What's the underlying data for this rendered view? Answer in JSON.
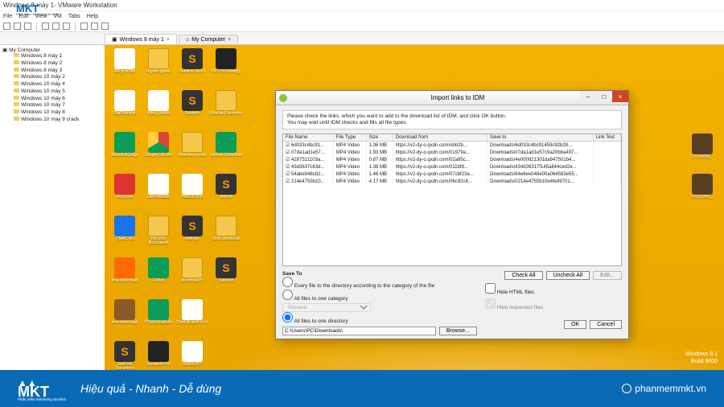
{
  "app": {
    "title_suffix": " - VMware Workstation"
  },
  "menu": [
    "File",
    "Edit",
    "View",
    "VM",
    "Tabs",
    "Help"
  ],
  "tabs": [
    {
      "label": "Windows 8 máy 1",
      "active": true
    },
    {
      "label": "My Computer",
      "active": false
    }
  ],
  "tree": {
    "root": "My Computer",
    "items": [
      "Windows 8 máy 1",
      "Windows 8 máy 2",
      "Windows 8 máy 3",
      "Windows 10 máy 2",
      "Windows 10 máy 4",
      "Windows 10 máy 5",
      "Windows 10 máy 6",
      "Windows 10 máy 7",
      "Windows 10 máy 8",
      "Windows 10 may 9 crack"
    ]
  },
  "desktop_icons": [
    {
      "label": "Recycle Bin",
      "cls": "col-white"
    },
    {
      "label": "regioncyjetim",
      "cls": "col-folder"
    },
    {
      "label": "Sublime Text 3",
      "cls": "col-subl"
    },
    {
      "label": "HTTPS Debuggr",
      "cls": "col-dark"
    },
    {
      "label": "CaalShavesc",
      "cls": "col-white"
    },
    {
      "label": "chen_Lun.txt",
      "cls": "col-white"
    },
    {
      "label": "Sublextr",
      "cls": "col-subl"
    },
    {
      "label": "Khardat Document",
      "cls": "col-folder"
    },
    {
      "label": "Microsoft Edge",
      "cls": "col-green"
    },
    {
      "label": "Google Chrome",
      "cls": "col-chrome"
    },
    {
      "label": "Kharekeyr code",
      "cls": "col-folder"
    },
    {
      "label": "Internet Download",
      "cls": "col-green"
    },
    {
      "label": "AnyDesk",
      "cls": "col-red"
    },
    {
      "label": "Làm website",
      "cls": "col-white"
    },
    {
      "label": "5442067095",
      "cls": "col-white"
    },
    {
      "label": "video8",
      "cls": "col-subl"
    },
    {
      "label": "TMAC v6",
      "cls": "col-blue"
    },
    {
      "label": "mycycle filcctioalset",
      "cls": "col-folder"
    },
    {
      "label": "videopy",
      "cls": "col-subl"
    },
    {
      "label": "code download",
      "cls": "col-folder"
    },
    {
      "label": "time-download",
      "cls": "col-orange"
    },
    {
      "label": "FPlus",
      "cls": "col-green"
    },
    {
      "label": "dienthoaiPP",
      "cls": "col-folder"
    },
    {
      "label": "Sublslot",
      "cls": "col-subl"
    },
    {
      "label": "time-download",
      "cls": "col-brown"
    },
    {
      "label": "FPlusScheduler",
      "cls": "col-green"
    },
    {
      "label": "Thiết kế web cơ b",
      "cls": "col-white"
    },
    {
      "label": "",
      "cls": ""
    },
    {
      "label": "SublText Document",
      "cls": "col-subl"
    },
    {
      "label": "UpdateAPKs",
      "cls": "col-dark"
    },
    {
      "label": "UniKeyNT",
      "cls": "col-white"
    }
  ],
  "right_icons": [
    {
      "label": "DT29998_"
    },
    {
      "label": "DT191841_"
    }
  ],
  "dialog": {
    "title": "Import links to IDM",
    "message_l1": "Please check the links, which you want to add to the download list of IDM, and click OK button.",
    "message_l2": "You may wait until IDM checks and fills all file types.",
    "columns": [
      "File Name",
      "File Type",
      "Size",
      "Download from",
      "Save to",
      "Link Text"
    ],
    "rows": [
      {
        "fn": "6d033c4bc91...",
        "ft": "MP4 Video",
        "sz": "1.36 MB",
        "df": "https://v2-dy-o.qxdn.com/obb2b...",
        "st": "Downloads\\6d033c4bc91459c92b28...",
        "lt": ""
      },
      {
        "fn": "07da1ad1e57...",
        "ft": "MP4 Video",
        "sz": "1.93 MB",
        "df": "https://v2-dy-o.qxdn.com/01979a...",
        "st": "Downloads\\07da1ad1e57c9a20bba497...",
        "lt": ""
      },
      {
        "fn": "4287521103a...",
        "ft": "MP4 Video",
        "sz": "0.87 MB",
        "df": "https://v2-dy-o.qxdn.com/02a95c...",
        "st": "Downloads\\4e000921301da947501b4...",
        "lt": ""
      },
      {
        "fn": "43d3637c63d...",
        "ft": "MP4 Video",
        "sz": "1.38 MB",
        "df": "https://v2-dy-o.qxdn.com/011bf8...",
        "st": "Downloads\\434d36317f145a844ced2e...",
        "lt": ""
      },
      {
        "fn": "54abe848c82...",
        "ft": "MP4 Video",
        "sz": "1.46 MB",
        "df": "https://v2-dy-o.qxdn.com/07cbf23a...",
        "st": "Downloads\\64e6ee048e00a064583e55...",
        "lt": ""
      },
      {
        "fn": "214e4753b10...",
        "ft": "MP4 Video",
        "sz": "4.17 MB",
        "df": "https://v2-dy-o.qxdn.com/06c92c4...",
        "st": "Downloads\\0214e4755b10e4fe49701...",
        "lt": ""
      }
    ],
    "save_to_label": "Save To",
    "opt_category": "Every file to the directory according to the category of the file",
    "opt_one_cat": "All files to one category",
    "cat_value": "General",
    "opt_one_dir": "All files to one directory",
    "dir_value": "C:\\Users\\PC\\Downloads\\",
    "browse": "Browse...",
    "check_all": "Check All",
    "uncheck_all": "Uncheck All",
    "edit": "Edit...",
    "hide_html": "Hide HTML files",
    "hide_req": "Hide requested files",
    "ok": "OK",
    "cancel": "Cancel"
  },
  "build": {
    "l1": "Windows 8.1",
    "l2": "Build 9600"
  },
  "brand": {
    "logo": "MKT",
    "tag": "Phần mềm Marketing đa kênh",
    "slogan": "Hiệu quả - Nhanh - Dễ dùng",
    "site": "phanmemmkt.vn"
  }
}
